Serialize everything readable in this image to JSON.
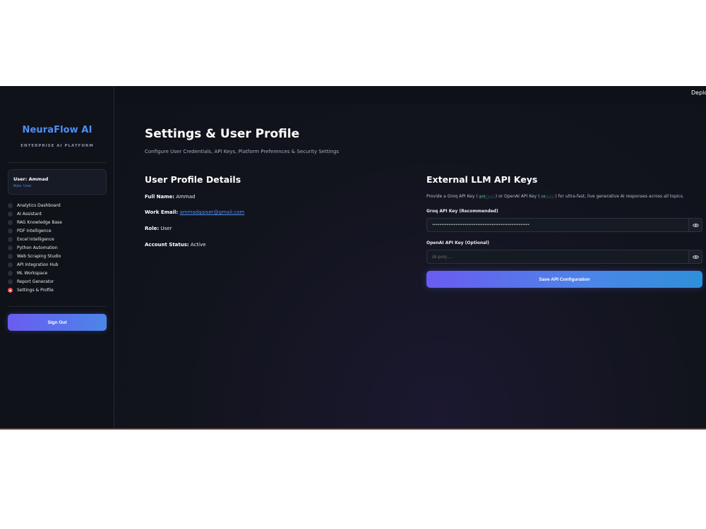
{
  "sidebar": {
    "brand": "NeuraFlow AI",
    "brand_subtitle": "ENTERPRISE AI PLATFORM",
    "user_name": "User: Ammad",
    "user_role": "Role: User",
    "nav": [
      {
        "label": "Analytics Dashboard",
        "selected": false
      },
      {
        "label": "AI Assistant",
        "selected": false
      },
      {
        "label": "RAG Knowledge Base",
        "selected": false
      },
      {
        "label": "PDF Intelligence",
        "selected": false
      },
      {
        "label": "Excel Intelligence",
        "selected": false
      },
      {
        "label": "Python Automation",
        "selected": false
      },
      {
        "label": "Web Scraping Studio",
        "selected": false
      },
      {
        "label": "API Integration Hub",
        "selected": false
      },
      {
        "label": "ML Workspace",
        "selected": false
      },
      {
        "label": "Report Generator",
        "selected": false
      },
      {
        "label": "Settings & Profile",
        "selected": true
      }
    ],
    "sign_out": "Sign Out"
  },
  "topbar": {
    "deploy": "Deploy"
  },
  "page": {
    "title": "Settings & User Profile",
    "subtitle": "Configure User Credentials, API Keys, Platform Preferences & Security Settings"
  },
  "profile": {
    "title": "User Profile Details",
    "full_name_label": "Full Name:",
    "full_name": "Ammad",
    "email_label": "Work Email:",
    "email": "ammadqaiser@gmail.com",
    "role_label": "Role:",
    "role": "User",
    "status_label": "Account Status:",
    "status": "Active"
  },
  "api": {
    "title": "External LLM API Keys",
    "desc_1": "Provide a Groq API Key (",
    "groq_prefix": "gsk_...",
    "desc_2": ") or OpenAI API Key (",
    "openai_prefix": "sk-...",
    "desc_3": ") for ultra-fast, live generative AI responses across all topics.",
    "groq_label": "Groq API Key (Recommended)",
    "groq_value": "••••••••••••••••••••••••••••••••••••••••••••••••••••••",
    "openai_label": "OpenAI API Key (Optional)",
    "openai_placeholder": "sk-proj-...",
    "save": "Save API Configuration"
  }
}
